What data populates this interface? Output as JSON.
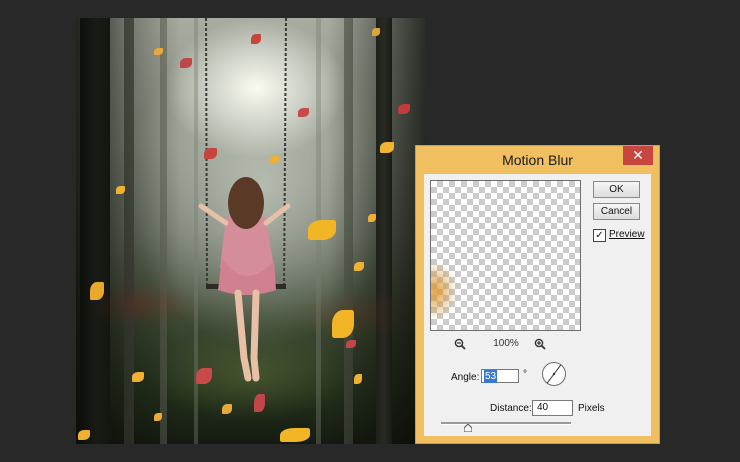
{
  "canvas": {
    "scene": "woman on a swing in a misty forest with falling leaves"
  },
  "motion_blur_dialog": {
    "title": "Motion Blur",
    "close_glyph": "✕",
    "ok_label": "OK",
    "cancel_label": "Cancel",
    "preview_label": "Preview",
    "preview_checked": true,
    "zoom_level": "100%",
    "angle_label": "Angle:",
    "angle_value": "53",
    "degree_symbol": "°",
    "distance_label": "Distance:",
    "distance_value": "40",
    "pixels_label": "Pixels",
    "distance_slider_value": 40
  },
  "colors": {
    "app_background": "#282828",
    "dialog_frame": "#f0c060",
    "close_button": "#c7463f",
    "selection": "#3a78d0"
  },
  "icons": [
    "zoom-out-icon",
    "zoom-in-icon",
    "close-icon",
    "checkmark-icon"
  ]
}
